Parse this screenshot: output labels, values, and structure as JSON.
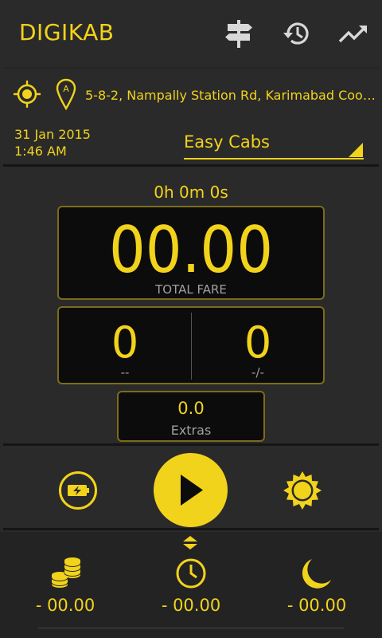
{
  "header": {
    "title": "DIGIKAB",
    "icons": [
      "signpost-icon",
      "history-icon",
      "trending-up-icon"
    ]
  },
  "location": {
    "address": "5-8-2, Nampally Station Rd, Karimabad Cooperat...",
    "pin_letter": "A"
  },
  "datetime": {
    "date": "31 Jan 2015",
    "time": "1:46 AM"
  },
  "cab": {
    "selected": "Easy Cabs"
  },
  "meter": {
    "elapsed": "0h 0m 0s",
    "total_fare": "00.00",
    "total_fare_label": "TOTAL FARE",
    "distance_value": "0",
    "distance_unit": "--",
    "amount_value": "0",
    "amount_unit": "-/-",
    "extras_value": "0.0",
    "extras_label": "Extras"
  },
  "controls": {
    "left_icon": "battery-charging-icon",
    "center_icon": "play-icon",
    "right_icon": "sun-icon"
  },
  "summary": {
    "coins_value": "-  00.00",
    "clock_value": "-  00.00",
    "night_value": "-  00.00"
  },
  "colors": {
    "accent": "#f2d31b",
    "background": "#2a2a2a",
    "meter_bg": "#0c0c0c",
    "label_gray": "#a0a0a0"
  }
}
